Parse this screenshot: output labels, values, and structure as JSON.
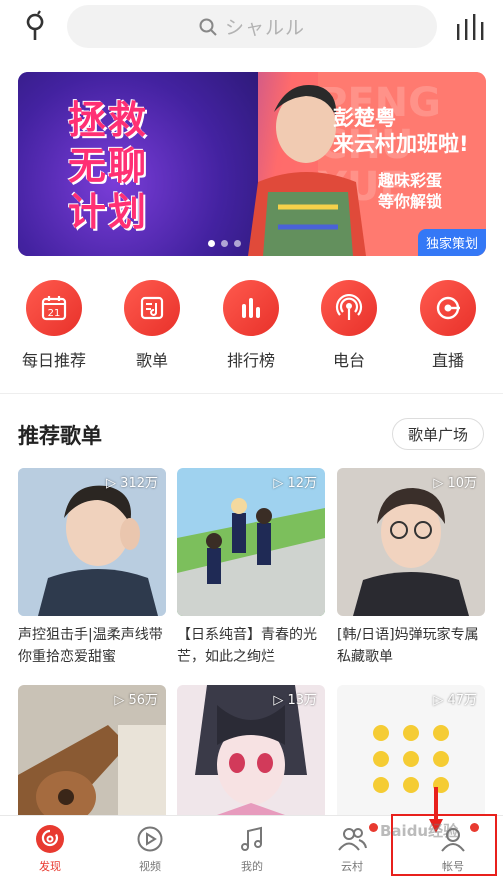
{
  "search": {
    "placeholder": "シャルル"
  },
  "banner": {
    "title_lines": [
      "拯救",
      "无聊",
      "计划"
    ],
    "headline": "彭楚粤",
    "subheadline": "来云村加班啦!",
    "tagline1": "趣味彩蛋",
    "tagline2": "等你解锁",
    "bg_letters": "PENG CHU YUE",
    "badge": "独家策划"
  },
  "quick_nav": [
    {
      "label": "每日推荐",
      "icon": "calendar-icon",
      "day": "21"
    },
    {
      "label": "歌单",
      "icon": "playlist-icon"
    },
    {
      "label": "排行榜",
      "icon": "chart-bars-icon"
    },
    {
      "label": "电台",
      "icon": "radio-icon"
    },
    {
      "label": "直播",
      "icon": "live-icon"
    }
  ],
  "section": {
    "title": "推荐歌单",
    "more_label": "歌单广场"
  },
  "playlists": [
    {
      "count": "▷ 312万",
      "title": "声控狙击手|温柔声线带你重拾恋爱甜蜜",
      "color": "#c9d8e8"
    },
    {
      "count": "▷ 12万",
      "title": "【日系纯音】青春的光芒，如此之绚烂",
      "color": "#8fc97a"
    },
    {
      "count": "▷ 10万",
      "title": "[韩/日语]妈弹玩家专属私藏歌单",
      "color": "#c8c3be"
    },
    {
      "count": "▷ 56万",
      "title": "",
      "color": "#b48a66"
    },
    {
      "count": "▷ 13万",
      "title": "",
      "color": "#e7c9d6"
    },
    {
      "count": "▷ 47万",
      "title": "",
      "color": "#f4f4f4"
    }
  ],
  "bottom_nav": [
    {
      "label": "发现",
      "icon": "netease-logo-icon",
      "active": true
    },
    {
      "label": "视频",
      "icon": "video-play-icon"
    },
    {
      "label": "我的",
      "icon": "music-note-icon"
    },
    {
      "label": "云村",
      "icon": "friends-icon"
    },
    {
      "label": "帐号",
      "icon": "account-icon"
    }
  ],
  "watermark": "Baidu经验",
  "colors": {
    "accent": "#e83a30",
    "search_bg": "#f2f2f2"
  }
}
